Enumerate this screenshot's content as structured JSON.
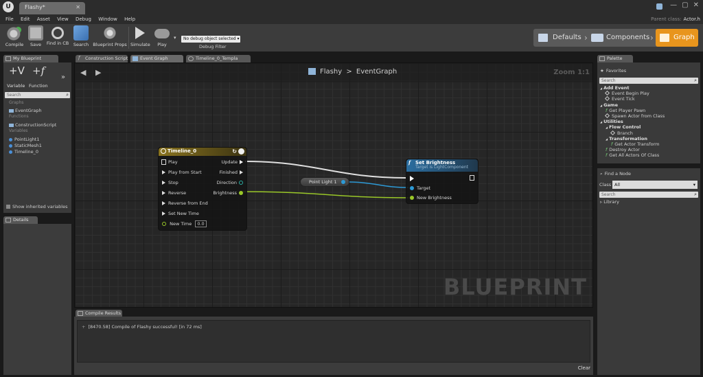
{
  "window": {
    "tab_title": "Flashy*",
    "close": "✕",
    "controls": [
      "—",
      "▢",
      "✕"
    ]
  },
  "menu": [
    "File",
    "Edit",
    "Asset",
    "View",
    "Debug",
    "Window",
    "Help"
  ],
  "parent_class": {
    "label": "Parent class:",
    "value": "Actor.h"
  },
  "toolbar": {
    "compile": "Compile",
    "save": "Save",
    "find_in_cb": "Find in CB",
    "search": "Search",
    "blueprint_props": "Blueprint Props",
    "simulate": "Simulate",
    "play": "Play",
    "debug_object": "No debug object selected ▾",
    "debug_filter": "Debug Filter"
  },
  "modes": {
    "defaults": "Defaults",
    "components": "Components",
    "graph": "Graph"
  },
  "left_panel": {
    "tab": "My Blueprint",
    "add_variable": "Variable",
    "add_function": "Function",
    "search_placeholder": "Search",
    "graphs_section": "Graphs",
    "graph_item": "EventGraph",
    "functions_section": "Functions",
    "function_item": "ConstructionScript",
    "variables_section": "Variables",
    "variables": [
      "PointLight1",
      "StaticMesh1",
      "Timeline_0"
    ],
    "show_inherited": "Show inherited variables"
  },
  "details_tab": "Details",
  "graph_tabs": [
    "Construction Script",
    "Event Graph",
    "Timeline_0_Templa"
  ],
  "graph": {
    "breadcrumb_bp": "Flashy",
    "breadcrumb_sep": ">",
    "breadcrumb_graph": "EventGraph",
    "zoom": "Zoom 1:1",
    "watermark": "BLUEPRINT"
  },
  "timeline_node": {
    "title": "Timeline_0",
    "inputs": [
      "Play",
      "Play from Start",
      "Stop",
      "Reverse",
      "Reverse from End",
      "Set New Time"
    ],
    "new_time_label": "New Time",
    "new_time_value": "0.0",
    "outputs": [
      "Update",
      "Finished",
      "Direction",
      "Brightness"
    ]
  },
  "var_node": {
    "label": "Point Light 1"
  },
  "set_brightness_node": {
    "title": "Set Brightness",
    "subtitle": "Target is LightComponent",
    "target": "Target",
    "new_brightness": "New Brightness"
  },
  "compile_results": {
    "tab": "Compile Results",
    "message": "[8470.58] Compile of Flashy successful! [in 72 ms]",
    "clear": "Clear"
  },
  "palette": {
    "tab": "Palette",
    "favorites": "Favorites",
    "search_placeholder": "Search",
    "items": [
      {
        "text": "Add Event",
        "kind": "cat",
        "indent": 0
      },
      {
        "text": "Event Begin Play",
        "kind": "event",
        "indent": 1
      },
      {
        "text": "Event Tick",
        "kind": "event",
        "indent": 1
      },
      {
        "text": "Game",
        "kind": "cat",
        "indent": 0
      },
      {
        "text": "Get Player Pawn",
        "kind": "fn",
        "indent": 1
      },
      {
        "text": "Spawn Actor from Class",
        "kind": "event",
        "indent": 1
      },
      {
        "text": "Utilities",
        "kind": "cat",
        "indent": 0
      },
      {
        "text": "Flow Control",
        "kind": "cat",
        "indent": 1
      },
      {
        "text": "Branch",
        "kind": "event",
        "indent": 2
      },
      {
        "text": "Transformation",
        "kind": "cat",
        "indent": 1
      },
      {
        "text": "Get Actor Transform",
        "kind": "fn",
        "indent": 2
      },
      {
        "text": "Destroy Actor",
        "kind": "fn",
        "indent": 1
      },
      {
        "text": "Get All Actors Of Class",
        "kind": "fn",
        "indent": 1
      }
    ]
  },
  "find_node": {
    "title": "Find a Node",
    "class_label": "Class",
    "class_value": "All",
    "search_placeholder": "Search",
    "library": "Library"
  },
  "colors": {
    "accent": "#e8951d",
    "timeline_head": "#8a7420",
    "function_head": "#2b6ea0",
    "exec_wire": "#e0e0e0",
    "object_wire": "#2d9ad6",
    "float_wire": "#9ac828"
  }
}
